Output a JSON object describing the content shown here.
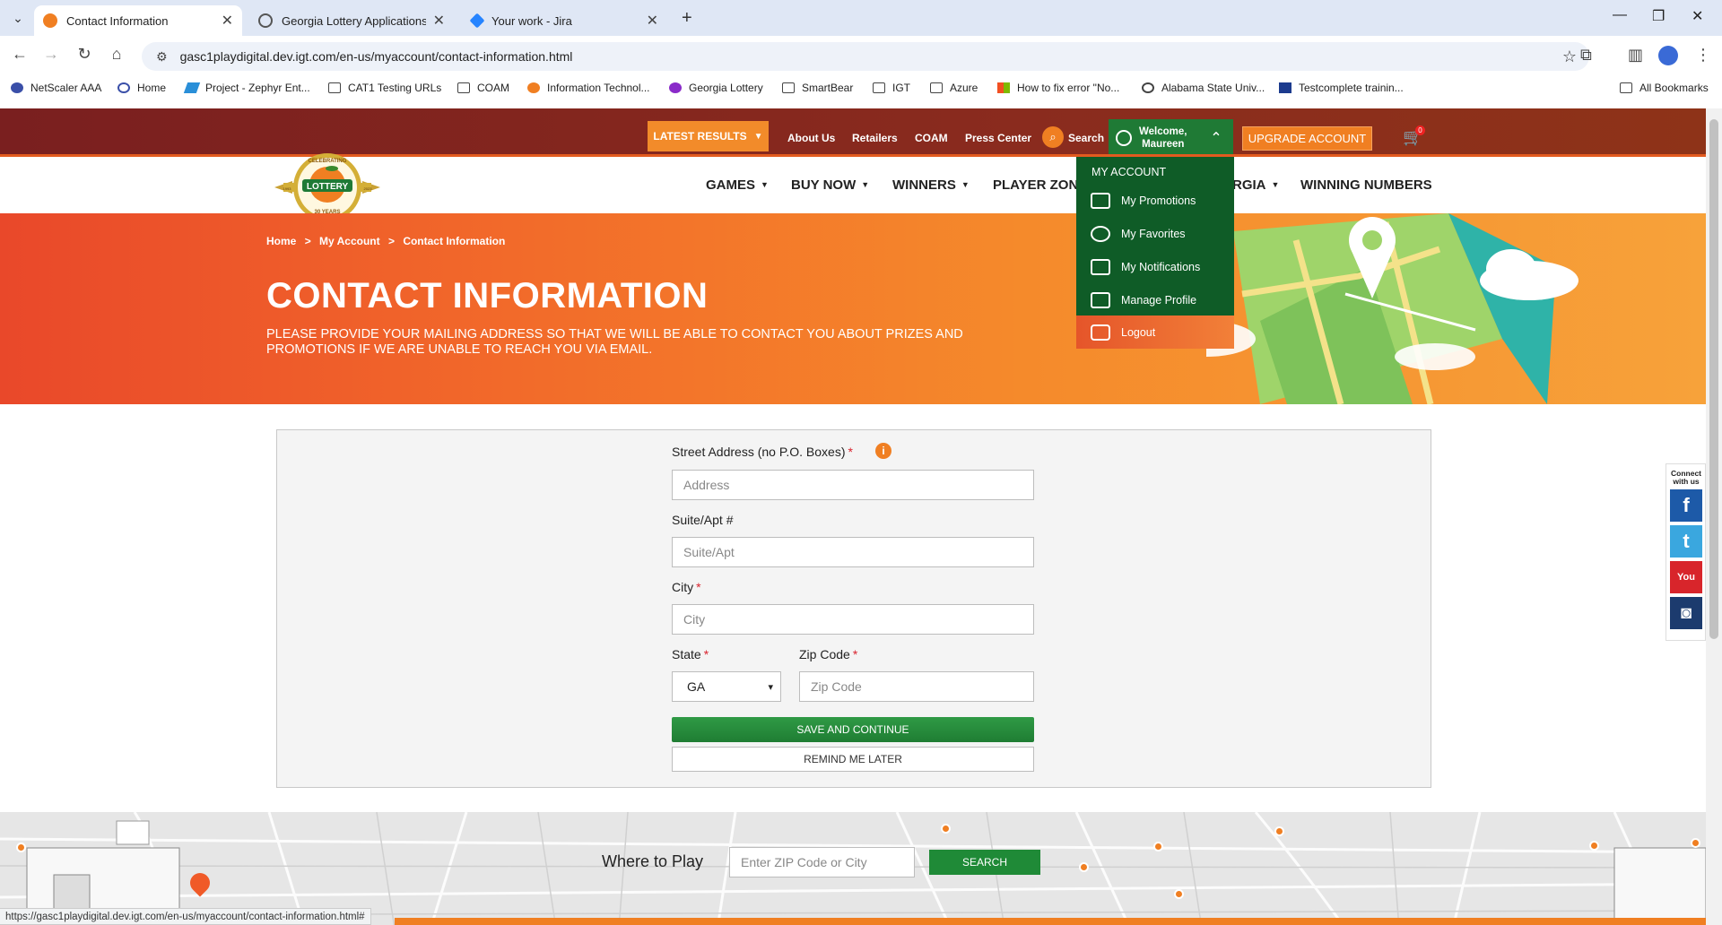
{
  "browser": {
    "tabs": [
      {
        "title": "Contact Information",
        "active": true,
        "favicon_color": "#f07f22"
      },
      {
        "title": "Georgia Lottery Applications",
        "active": false,
        "favicon_color": "#555555"
      },
      {
        "title": "Your work - Jira",
        "active": false,
        "favicon_color": "#2684ff"
      }
    ],
    "url": "gasc1playdigital.dev.igt.com/en-us/myaccount/contact-information.html",
    "bookmarks": [
      {
        "label": "NetScaler AAA",
        "icon": "lock-icon"
      },
      {
        "label": "Home",
        "icon": "globe-icon"
      },
      {
        "label": "Project - Zephyr Ent...",
        "icon": "zephyr-icon"
      },
      {
        "label": "CAT1 Testing URLs",
        "icon": "folder-icon"
      },
      {
        "label": "COAM",
        "icon": "folder-icon"
      },
      {
        "label": "Information Technol...",
        "icon": "peach-icon"
      },
      {
        "label": "Georgia Lottery",
        "icon": "ga-icon"
      },
      {
        "label": "SmartBear",
        "icon": "folder-icon"
      },
      {
        "label": "IGT",
        "icon": "folder-icon"
      },
      {
        "label": "Azure",
        "icon": "folder-icon"
      },
      {
        "label": "How to fix error \"No...",
        "icon": "windows-icon"
      },
      {
        "label": "Alabama State Univ...",
        "icon": "globe-icon"
      },
      {
        "label": "Testcomplete trainin...",
        "icon": "tc-icon"
      }
    ],
    "all_bookmarks": "All Bookmarks",
    "status_url": "https://gasc1playdigital.dev.igt.com/en-us/myaccount/contact-information.html#"
  },
  "site": {
    "topbar": {
      "latest_results": "LATEST RESULTS",
      "links": [
        "About Us",
        "Retailers",
        "COAM",
        "Press Center"
      ],
      "search": "Search",
      "welcome_line1": "Welcome,",
      "welcome_line2": "Maureen",
      "upgrade": "UPGRADE ACCOUNT",
      "cart_count": "0"
    },
    "logo": {
      "text": "LOTTERY",
      "arc": "CELEBRATING",
      "years": "30 YEARS",
      "left": "1993",
      "right": "2023"
    },
    "nav": [
      {
        "label": "GAMES",
        "caret": true
      },
      {
        "label": "BUY NOW",
        "caret": true
      },
      {
        "label": "WINNERS",
        "caret": true
      },
      {
        "label": "PLAYER ZONE",
        "caret": false
      },
      {
        "label": "RGIA",
        "caret": true
      },
      {
        "label": "WINNING NUMBERS",
        "caret": false
      }
    ],
    "account_menu": {
      "heading": "MY ACCOUNT",
      "items": [
        {
          "label": "My Promotions",
          "icon": "promotions-icon"
        },
        {
          "label": "My Favorites",
          "icon": "heart-icon"
        },
        {
          "label": "My Notifications",
          "icon": "envelope-icon"
        },
        {
          "label": "Manage Profile",
          "icon": "profile-card-icon"
        },
        {
          "label": "Logout",
          "icon": "logout-icon"
        }
      ]
    },
    "hero": {
      "breadcrumb": [
        "Home",
        ">",
        "My Account",
        ">",
        "Contact Information"
      ],
      "title": "CONTACT INFORMATION",
      "subtitle": "PLEASE PROVIDE YOUR MAILING ADDRESS SO THAT WE WILL BE ABLE TO CONTACT YOU ABOUT PRIZES AND PROMOTIONS IF WE ARE UNABLE TO REACH YOU VIA EMAIL."
    },
    "form": {
      "street_label": "Street Address (no P.O. Boxes)",
      "street_placeholder": "Address",
      "suite_label": "Suite/Apt #",
      "suite_placeholder": "Suite/Apt",
      "city_label": "City",
      "city_placeholder": "City",
      "state_label": "State",
      "state_value": "GA",
      "zip_label": "Zip Code",
      "zip_placeholder": "Zip Code",
      "required_mark": "*",
      "info_mark": "i",
      "save": "SAVE AND CONTINUE",
      "remind": "REMIND ME LATER"
    },
    "where_to_play": {
      "label": "Where to Play",
      "placeholder": "Enter ZIP Code or City",
      "button": "SEARCH"
    },
    "social": {
      "label": "Connect with us",
      "items": [
        {
          "name": "facebook",
          "glyph": "f",
          "color": "#1d5aa8"
        },
        {
          "name": "twitter",
          "glyph": "t",
          "color": "#3aa7df"
        },
        {
          "name": "youtube",
          "glyph": "You",
          "color": "#d8252b"
        },
        {
          "name": "instagram",
          "glyph": "◙",
          "color": "#1c3b6e"
        }
      ]
    }
  }
}
